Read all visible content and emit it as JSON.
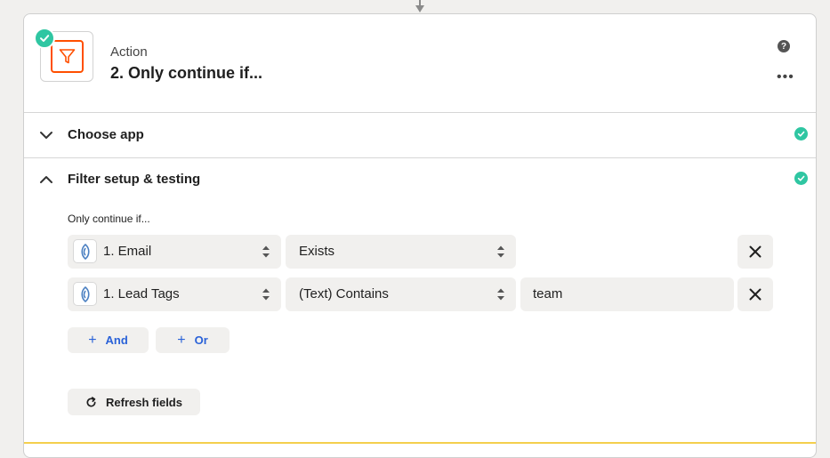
{
  "step": {
    "type_label": "Action",
    "title": "2. Only continue if...",
    "help_glyph": "?",
    "more_glyph": "•••"
  },
  "sections": {
    "choose_app": {
      "label": "Choose app",
      "expanded": false,
      "complete": true
    },
    "filter_setup": {
      "label": "Filter setup & testing",
      "expanded": true,
      "complete": true
    }
  },
  "filter": {
    "heading": "Only continue if...",
    "conditions": [
      {
        "field": "1. Email",
        "operator": "Exists",
        "value": ""
      },
      {
        "field": "1. Lead Tags",
        "operator": "(Text) Contains",
        "value": "team"
      }
    ],
    "and_label": "And",
    "or_label": "Or",
    "refresh_label": "Refresh fields"
  },
  "colors": {
    "accent_orange": "#ff4f00",
    "success_green": "#2fc6a2",
    "link_blue": "#2a62d8",
    "warning_yellow": "#f4cf4d"
  },
  "icons": {
    "app": "filter-funnel-icon",
    "status": "check-circle-icon",
    "field_source": "app-logo-icon",
    "remove": "close-icon"
  }
}
